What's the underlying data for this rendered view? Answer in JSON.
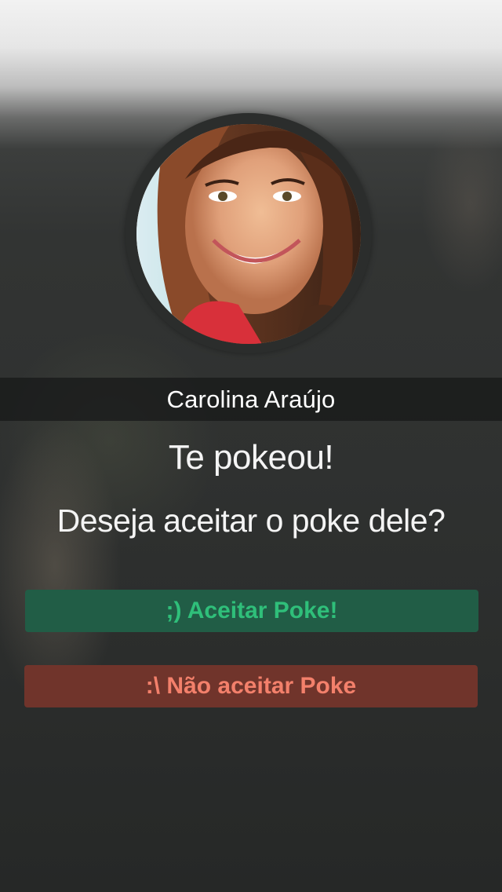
{
  "profile": {
    "name": "Carolina Araújo"
  },
  "message": {
    "headline": "Te pokeou!",
    "question": "Deseja aceitar o poke dele?"
  },
  "actions": {
    "accept_label": ";)  Aceitar Poke!",
    "reject_label": ":\\ Não aceitar Poke"
  },
  "colors": {
    "accept_bg": "#215d46",
    "accept_text": "#2fbf7a",
    "reject_bg": "#70342b",
    "reject_text": "#f3806b",
    "name_bar_bg": "#181919"
  }
}
